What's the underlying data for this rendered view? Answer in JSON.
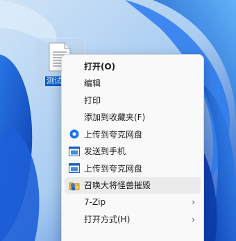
{
  "desktop": {
    "file": {
      "label": "测试",
      "icon": "text-document-icon"
    }
  },
  "context_menu": {
    "items": [
      {
        "label": "打开(O)",
        "icon": "",
        "bold": true
      },
      {
        "label": "编辑",
        "icon": ""
      },
      {
        "label": "打印",
        "icon": ""
      },
      {
        "label": "添加到收藏夹(F)",
        "icon": ""
      },
      {
        "label": "上传到夸克网盘",
        "icon": "quark-cloud-icon"
      },
      {
        "label": "发送到手机",
        "icon": "phone-window-icon"
      },
      {
        "label": "上传到夸克网盘",
        "icon": "window-icon"
      },
      {
        "label": "召唤大将怪兽摧毁",
        "icon": "monster-folder-icon",
        "hovered": true
      },
      {
        "label": "7-Zip",
        "icon": "",
        "submenu": true
      },
      {
        "label": "打开方式(H)",
        "icon": "",
        "submenu": true
      }
    ]
  },
  "colors": {
    "wallpaper_dark": "#0a3fb8",
    "wallpaper_light": "#4aa0f0",
    "selection": "#0c5fc8",
    "menu_bg": "#f9f9f9",
    "hover": "#ebebeb",
    "accent_blue": "#1a73e8"
  }
}
